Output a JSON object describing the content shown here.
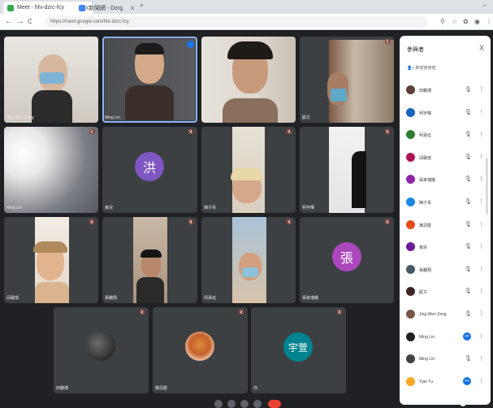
{
  "browser": {
    "tabs": [
      {
        "label": "Meet - hhi-dzrc-fcy",
        "close": "x"
      },
      {
        "label": "新聞網 - Dcrg",
        "close": "x"
      }
    ],
    "new_tab": "+",
    "controls": {
      "back": "←",
      "forward": "→",
      "reload": "C"
    },
    "url": "https://meet.google.com/hhi-dzrc-fcy",
    "window": {
      "minimize": "–"
    }
  },
  "tiles": [
    {
      "name": "Jing Wen Zeng",
      "kind": "video"
    },
    {
      "name": "Ming Lin",
      "kind": "video",
      "speaking": true
    },
    {
      "name": "",
      "kind": "video"
    },
    {
      "name": "歐文",
      "kind": "video"
    },
    {
      "name": "Ming Lin",
      "kind": "video"
    },
    {
      "name": "東宗",
      "kind": "avatar",
      "initial": "洪",
      "color": "#7e57c2"
    },
    {
      "name": "陳汐青",
      "kind": "video"
    },
    {
      "name": "柯宇暉",
      "kind": "video"
    },
    {
      "name": "邱麗琪",
      "kind": "video"
    },
    {
      "name": "黃鵬翔",
      "kind": "video"
    },
    {
      "name": "柯承廷",
      "kind": "video"
    },
    {
      "name": "張家瑞娥",
      "kind": "avatar",
      "initial": "張",
      "color": "#ab47bc"
    },
    {
      "name": "田鵬博",
      "kind": "video"
    },
    {
      "name": "陳羽霆",
      "kind": "video"
    },
    {
      "name": "你",
      "kind": "avatar",
      "initial": "宇萱",
      "color": "#00838f"
    }
  ],
  "panel": {
    "title": "參與者",
    "close": "X",
    "add_people": "新增使用者",
    "participants": [
      {
        "name": "田鵬博",
        "color": "#5d4037"
      },
      {
        "name": "柯宇暉",
        "color": "#1565c0"
      },
      {
        "name": "柯承廷",
        "color": "#2e7d32"
      },
      {
        "name": "邱麗琪",
        "color": "#ad1457"
      },
      {
        "name": "張家瑞娥",
        "color": "#8e24aa"
      },
      {
        "name": "陳汐青",
        "color": "#1e88e5"
      },
      {
        "name": "陳羽霆",
        "color": "#e64a19"
      },
      {
        "name": "東宗",
        "color": "#6a1b9a"
      },
      {
        "name": "黃鵬翔",
        "color": "#455a64"
      },
      {
        "name": "歐文",
        "color": "#3e2723"
      },
      {
        "name": "Jing Wen Zeng",
        "color": "#795548"
      },
      {
        "name": "Ming Lin",
        "color": "#212121",
        "speaking": true
      },
      {
        "name": "Ming Lin",
        "color": "#424242"
      },
      {
        "name": "Yjan Tu",
        "color": "#f9a825",
        "speaking": true
      }
    ]
  }
}
